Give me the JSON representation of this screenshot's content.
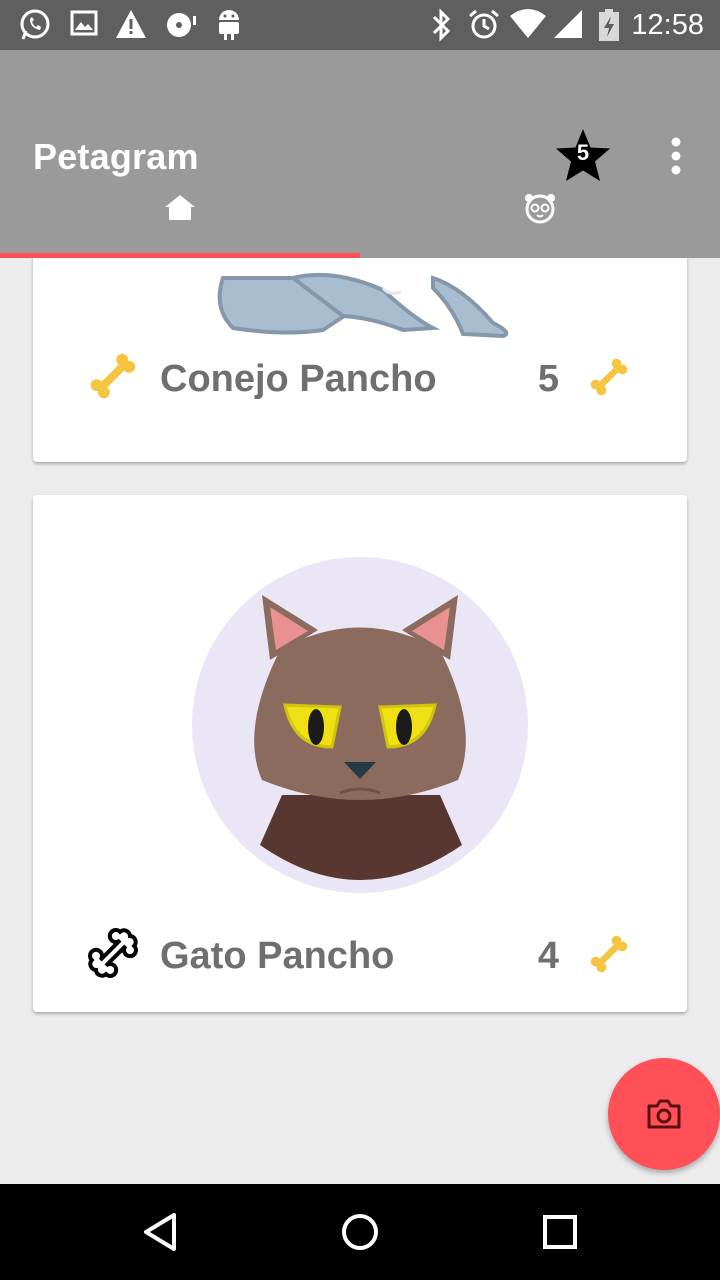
{
  "status_bar": {
    "time": "12:58",
    "icons": [
      "whatsapp-icon",
      "image-icon",
      "warning-icon",
      "disc-icon",
      "android-icon",
      "bluetooth-icon",
      "alarm-icon",
      "wifi-icon",
      "signal-icon",
      "battery-icon"
    ]
  },
  "app_bar": {
    "title": "Petagram",
    "favorites_count": "5",
    "icons": {
      "favorites": "star-icon",
      "overflow": "more-vert-icon"
    }
  },
  "tabs": [
    {
      "icon": "home-icon",
      "selected": true
    },
    {
      "icon": "pet-face-icon",
      "selected": false
    }
  ],
  "colors": {
    "status_bar": "#5f5f5f",
    "app_bar": "#9a9a9a",
    "accent": "#ff4f57",
    "bone_gold": "#f5c542",
    "text_secondary": "#6f6f6f",
    "background": "#ececec"
  },
  "pets": [
    {
      "name": "Conejo Pancho",
      "likes": "5",
      "liked": true,
      "photo": "rabbit-avatar"
    },
    {
      "name": "Gato Pancho",
      "likes": "4",
      "liked": false,
      "photo": "cat-avatar"
    }
  ],
  "fab": {
    "icon": "camera-icon"
  },
  "nav_bar": {
    "icons": [
      "back-icon",
      "home-circle-icon",
      "recents-icon"
    ]
  }
}
